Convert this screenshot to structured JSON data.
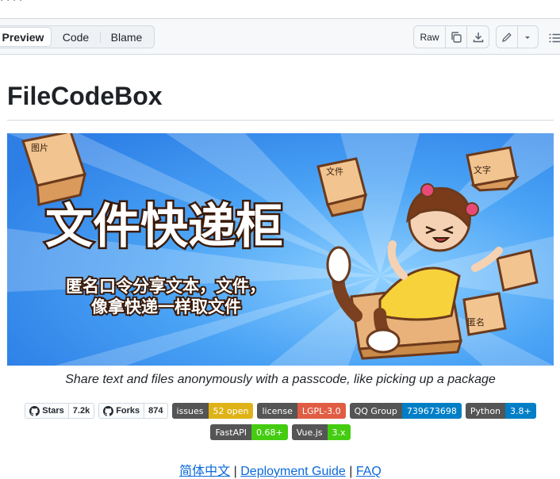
{
  "breadcrumb_partial": "· · ·  ·",
  "toolbar": {
    "tabs": [
      {
        "label": "Preview",
        "active": true
      },
      {
        "label": "Code",
        "active": false
      },
      {
        "label": "Blame",
        "active": false
      }
    ],
    "raw_label": "Raw",
    "icons": [
      "copy-icon",
      "download-icon",
      "pencil-icon",
      "chevron-down-icon",
      "list-icon"
    ]
  },
  "readme": {
    "title": "FileCodeBox",
    "banner": {
      "headline": "文件快递柜",
      "subline_1": "匿名口令分享文本，文件，",
      "subline_2": "像拿快递一样取文件",
      "box_labels": [
        "图片",
        "文件",
        "文字",
        "匿名"
      ]
    },
    "caption": "Share text and files anonymously with a passcode, like picking up a package",
    "github_badges": [
      {
        "label": "Stars",
        "value": "7.2k"
      },
      {
        "label": "Forks",
        "value": "874"
      }
    ],
    "shield_badges_row1": [
      {
        "label": "issues",
        "value": "52 open",
        "color": "#dfb317"
      },
      {
        "label": "license",
        "value": "LGPL-3.0",
        "color": "#e05d44"
      },
      {
        "label": "QQ Group",
        "value": "739673698",
        "color": "#007ec6"
      },
      {
        "label": "Python",
        "value": "3.8+",
        "color": "#007ec6"
      }
    ],
    "shield_badges_row2": [
      {
        "label": "FastAPI",
        "value": "0.68+",
        "color": "#4c1"
      },
      {
        "label": "Vue.js",
        "value": "3.x",
        "color": "#4c1"
      }
    ],
    "links": {
      "zh": "简体中文",
      "sep": "|",
      "deploy": "Deployment Guide",
      "faq": "FAQ"
    }
  }
}
